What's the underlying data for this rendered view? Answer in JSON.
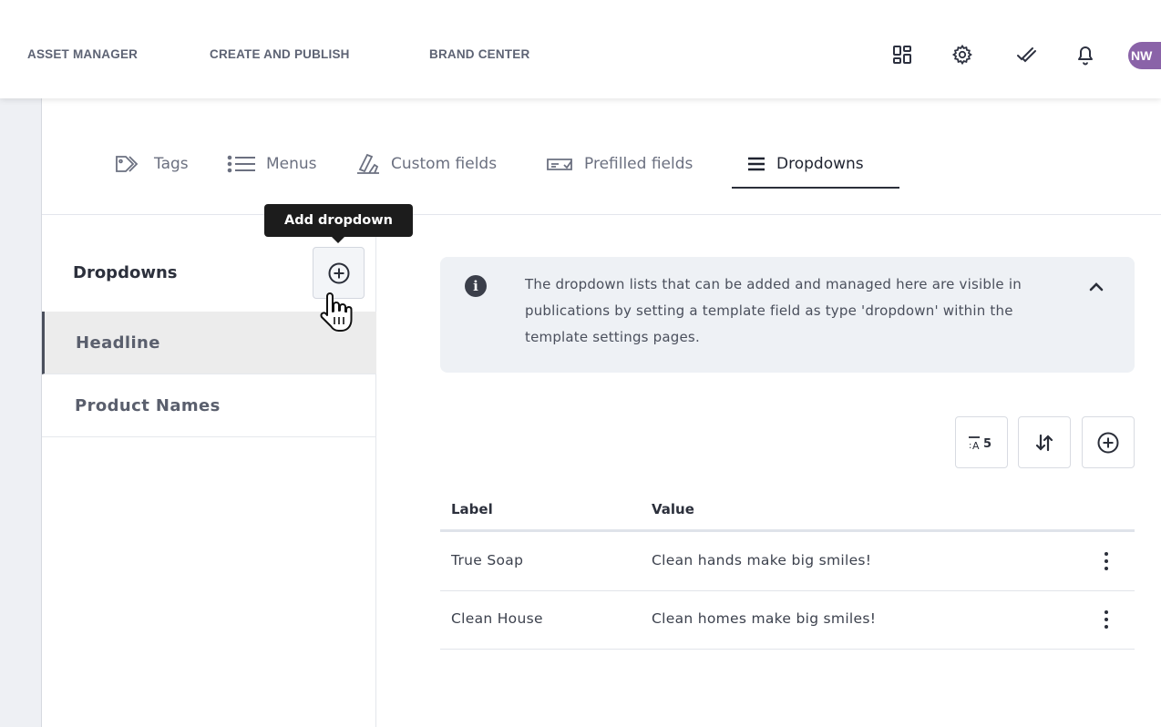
{
  "topnav": {
    "links": [
      "ASSET MANAGER",
      "CREATE AND PUBLISH",
      "BRAND CENTER"
    ],
    "icons": [
      "apps-grid-icon",
      "settings-gear-icon",
      "tasks-check-icon",
      "notifications-bell-icon"
    ],
    "avatar_initials": "NW",
    "avatar_color": "#8a63a8"
  },
  "tabs": [
    {
      "label": "Tags",
      "icon": "tag-icon",
      "active": false
    },
    {
      "label": "Menus",
      "icon": "list-icon",
      "active": false
    },
    {
      "label": "Custom fields",
      "icon": "ruler-pen-icon",
      "active": false
    },
    {
      "label": "Prefilled fields",
      "icon": "form-field-icon",
      "active": false
    },
    {
      "label": "Dropdowns",
      "icon": "hamburger-icon",
      "active": true
    }
  ],
  "tooltip": {
    "text": "Add dropdown"
  },
  "sidebar": {
    "title": "Dropdowns",
    "add_icon": "plus-circle-icon",
    "items": [
      {
        "label": "Headline",
        "selected": true
      },
      {
        "label": "Product Names",
        "selected": false
      }
    ]
  },
  "info": {
    "text": "The dropdown lists that can be added and managed here are visible in publications by setting a template field as type 'dropdown' within the template settings pages.",
    "icon": "info-icon",
    "collapse_icon": "chevron-up-icon"
  },
  "toolbar": {
    "buttons": [
      "sort-alpha-icon",
      "sort-order-icon",
      "add-circle-icon"
    ]
  },
  "table": {
    "columns": [
      "Label",
      "Value"
    ],
    "rows": [
      {
        "label": "True Soap",
        "value": "Clean hands make big smiles!"
      },
      {
        "label": "Clean House",
        "value": "Clean homes make big smiles!"
      }
    ]
  }
}
